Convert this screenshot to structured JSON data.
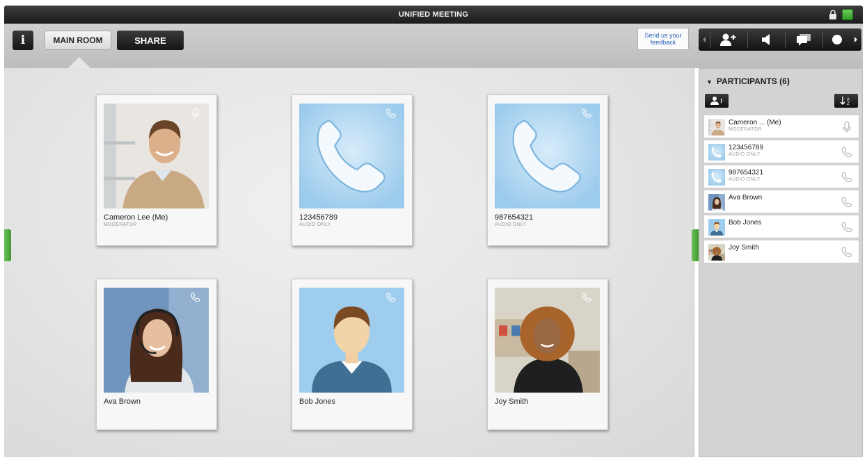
{
  "window": {
    "title": "UNIFIED MEETING"
  },
  "toolbar": {
    "info_label": "i",
    "tabs": [
      {
        "label": "MAIN ROOM",
        "active": true
      },
      {
        "label": "SHARE",
        "active": false
      }
    ],
    "feedback_label": "Send us your feedback",
    "controls": [
      "add-participant-icon",
      "speaker-icon",
      "chat-icon",
      "record-icon"
    ]
  },
  "tiles": [
    {
      "name": "Cameron Lee (Me)",
      "role": "MODERATOR",
      "avatar": "photo-man",
      "status_icon": "microphone-icon"
    },
    {
      "name": "123456789",
      "role": "AUDIO ONLY",
      "avatar": "phone",
      "status_icon": "phone-icon"
    },
    {
      "name": "987654321",
      "role": "AUDIO ONLY",
      "avatar": "phone",
      "status_icon": "phone-icon"
    },
    {
      "name": "Ava Brown",
      "role": "",
      "avatar": "photo-headset-woman",
      "status_icon": "phone-icon"
    },
    {
      "name": "Bob Jones",
      "role": "",
      "avatar": "generic-man",
      "status_icon": "phone-icon"
    },
    {
      "name": "Joy Smith",
      "role": "",
      "avatar": "photo-curly-woman",
      "status_icon": "phone-icon"
    }
  ],
  "participants": {
    "title": "PARTICIPANTS (6)",
    "items": [
      {
        "name": "Cameron ... (Me)",
        "role": "MODERATOR",
        "avatar": "photo-man",
        "status_icon": "microphone-icon"
      },
      {
        "name": "123456789",
        "role": "AUDIO ONLY",
        "avatar": "phone",
        "status_icon": "phone-icon"
      },
      {
        "name": "987654321",
        "role": "AUDIO ONLY",
        "avatar": "phone",
        "status_icon": "phone-icon"
      },
      {
        "name": "Ava Brown",
        "role": "",
        "avatar": "photo-headset-woman",
        "status_icon": "phone-icon"
      },
      {
        "name": "Bob Jones",
        "role": "",
        "avatar": "generic-man",
        "status_icon": "phone-icon"
      },
      {
        "name": "Joy Smith",
        "role": "",
        "avatar": "photo-curly-woman",
        "status_icon": "phone-icon"
      }
    ]
  },
  "colors": {
    "accent_green": "#4fae3c",
    "link_blue": "#2860b5",
    "tile_blue": "#a9d4ef"
  }
}
